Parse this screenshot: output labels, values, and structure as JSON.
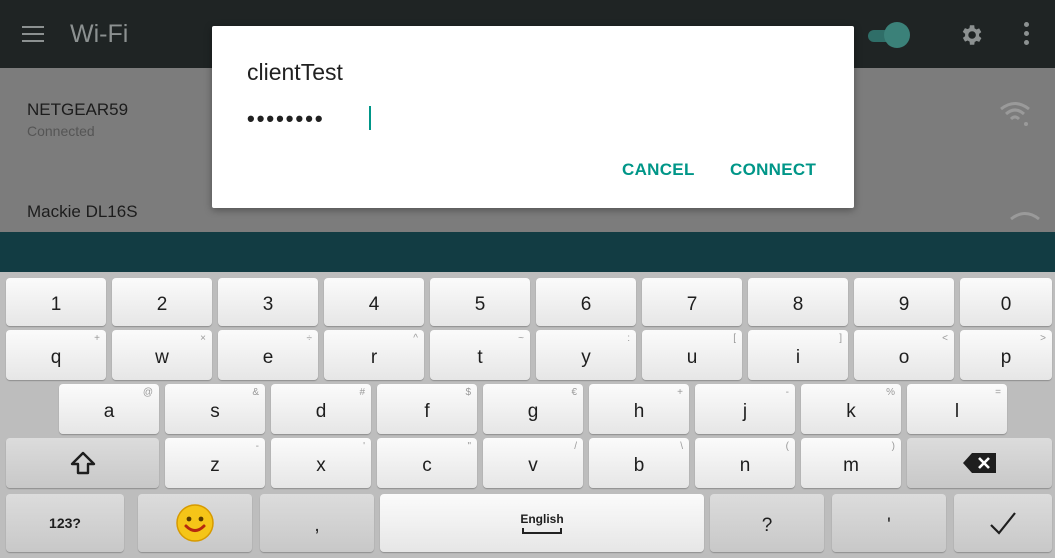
{
  "appbar": {
    "title": "Wi-Fi",
    "menu_icon": "menu-icon",
    "settings_icon": "gear-icon",
    "overflow_icon": "overflow-icon"
  },
  "networks": [
    {
      "name": "NETGEAR59",
      "status": "Connected"
    },
    {
      "name": "Mackie DL16S",
      "status": ""
    }
  ],
  "dialog": {
    "title": "clientTest",
    "password_value": "••••••••",
    "cancel_label": "CANCEL",
    "connect_label": "CONNECT"
  },
  "keyboard": {
    "number_row": [
      "1",
      "2",
      "3",
      "4",
      "5",
      "6",
      "7",
      "8",
      "9",
      "0"
    ],
    "row1": [
      {
        "k": "q",
        "h": "+"
      },
      {
        "k": "w",
        "h": "×"
      },
      {
        "k": "e",
        "h": "÷"
      },
      {
        "k": "r",
        "h": "^"
      },
      {
        "k": "t",
        "h": "~"
      },
      {
        "k": "y",
        "h": ":"
      },
      {
        "k": "u",
        "h": "["
      },
      {
        "k": "i",
        "h": "]"
      },
      {
        "k": "o",
        "h": "<"
      },
      {
        "k": "p",
        "h": ">"
      }
    ],
    "row2": [
      {
        "k": "a",
        "h": "@"
      },
      {
        "k": "s",
        "h": "&"
      },
      {
        "k": "d",
        "h": "#"
      },
      {
        "k": "f",
        "h": "$"
      },
      {
        "k": "g",
        "h": "€"
      },
      {
        "k": "h",
        "h": "+"
      },
      {
        "k": "j",
        "h": "-"
      },
      {
        "k": "k",
        "h": "%"
      },
      {
        "k": "l",
        "h": "="
      }
    ],
    "row3": [
      {
        "k": "z",
        "h": "-"
      },
      {
        "k": "x",
        "h": "'"
      },
      {
        "k": "c",
        "h": "\""
      },
      {
        "k": "v",
        "h": "/"
      },
      {
        "k": "b",
        "h": "\\"
      },
      {
        "k": "n",
        "h": "("
      },
      {
        "k": "m",
        "h": ")"
      }
    ],
    "bottom": {
      "symbols_label": "123?",
      "comma": ",",
      "space_label": "English",
      "question": "?",
      "apostrophe": "'",
      "emoji_icon": "emoji-smile-icon",
      "shift_icon": "shift-arrow-icon",
      "backspace_icon": "backspace-icon",
      "done_icon": "checkmark-icon"
    }
  },
  "colors": {
    "accent": "#009688",
    "appbar": "#1f2424",
    "scrim_bar": "#123c43"
  }
}
